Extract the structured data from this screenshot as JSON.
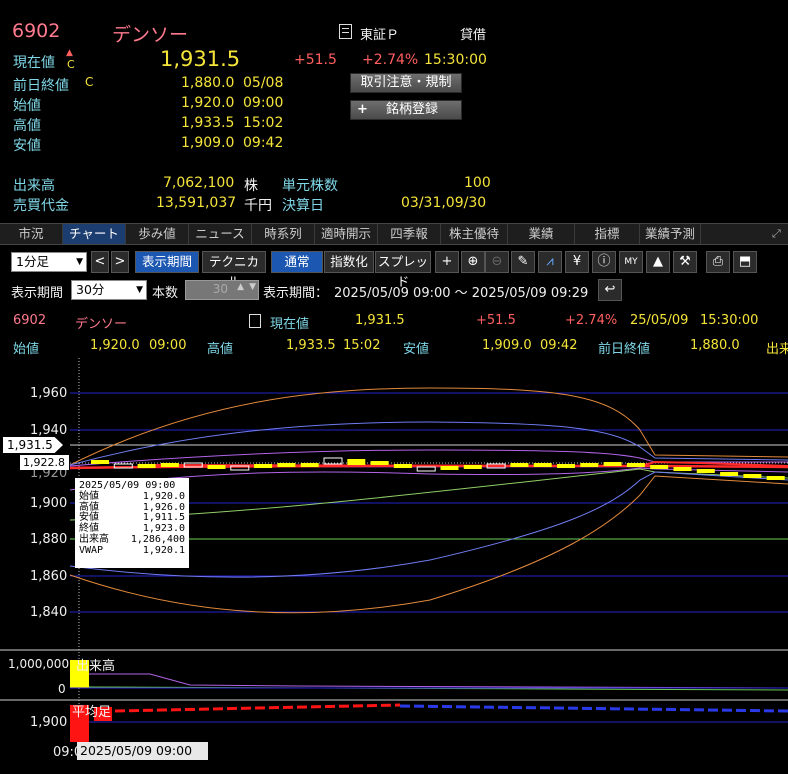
{
  "stock": {
    "code": "6902",
    "name": "デンソー",
    "market": "東証Ｐ",
    "margin": "貸借"
  },
  "price": {
    "label": "現在値",
    "mark_up": "▲",
    "mark_c": "C",
    "value": "1,931.5",
    "change": "+51.5",
    "change_pct": "+2.74%",
    "time": "15:30:00"
  },
  "info": [
    {
      "label": "前日終値",
      "flag": "C",
      "value": "1,880.0",
      "time": "05/08"
    },
    {
      "label": "始値",
      "value": "1,920.0",
      "time": "09:00"
    },
    {
      "label": "高値",
      "value": "1,933.5",
      "time": "15:02"
    },
    {
      "label": "安値",
      "value": "1,909.0",
      "time": "09:42"
    }
  ],
  "buttons": {
    "rules": "取引注意・規制",
    "register_plus": "+",
    "register": "銘柄登録"
  },
  "volume": {
    "label": "出来高",
    "value": "7,062,100",
    "unit": "株",
    "trade_unit_label": "単元株数",
    "trade_unit": "100"
  },
  "turnover": {
    "label": "売買代金",
    "value": "13,591,037",
    "unit": "千円",
    "settle_label": "決算日",
    "settle": "03/31,09/30"
  },
  "tabs": [
    "市況",
    "チャート",
    "歩み値",
    "ニュース",
    "時系列",
    "適時開示",
    "四季報",
    "株主優待",
    "業績",
    "指標",
    "業績予測"
  ],
  "toolbar": {
    "interval": "1分足",
    "prev": "<",
    "next": ">",
    "period_btn": "表示期間",
    "technical": "テクニカル",
    "normal": "通常",
    "index": "指数化",
    "spread": "スプレッド"
  },
  "toolbar2": {
    "period_label": "表示期間",
    "period": "30分",
    "count_label": "本数",
    "count": "30",
    "range_label": "表示期間：",
    "range": "2025/05/09 09:00 ～ 2025/05/09 09:29"
  },
  "quote_row1": {
    "code": "6902",
    "name": "デンソー",
    "cur_label": "現在値",
    "cur": "1,931.5",
    "change": "+51.5",
    "pct": "+2.74%",
    "date": "25/05/09",
    "time": "15:30:00"
  },
  "quote_row2": {
    "open_label": "始値",
    "open": "1,920.0",
    "open_t": "09:00",
    "high_label": "高値",
    "high": "1,933.5",
    "high_t": "15:02",
    "low_label": "安値",
    "low": "1,909.0",
    "low_t": "09:42",
    "prev_label": "前日終値",
    "prev": "1,880.0",
    "more": "出来"
  },
  "axis": {
    "y_ticks": [
      "1,960",
      "1,940",
      "1,920",
      "1,900",
      "1,880",
      "1,860",
      "1,840"
    ],
    "current_tag": "1,931.5",
    "cursor_tag": "1,922.8",
    "vol_label": "出来高",
    "vol_ticks": [
      "1,000,000",
      "0"
    ],
    "avg_label": "平均足",
    "avg_tick": "1,900",
    "x_tick": "09:0",
    "x_cursor": "2025/05/09 09:00"
  },
  "tooltip": {
    "date": "2025/05/09 09:00",
    "rows": [
      [
        "始値",
        "1,920.0"
      ],
      [
        "高値",
        "1,926.0"
      ],
      [
        "安値",
        "1,911.5"
      ],
      [
        "終値",
        "1,923.0"
      ],
      [
        "出来高",
        "1,286,400"
      ],
      [
        "VWAP",
        "1,920.1"
      ]
    ]
  },
  "colors": {
    "up": "#ff5f5f",
    "accent": "#f5e43a",
    "label": "#7fd7e7",
    "active_tab": "#1c3d70"
  }
}
